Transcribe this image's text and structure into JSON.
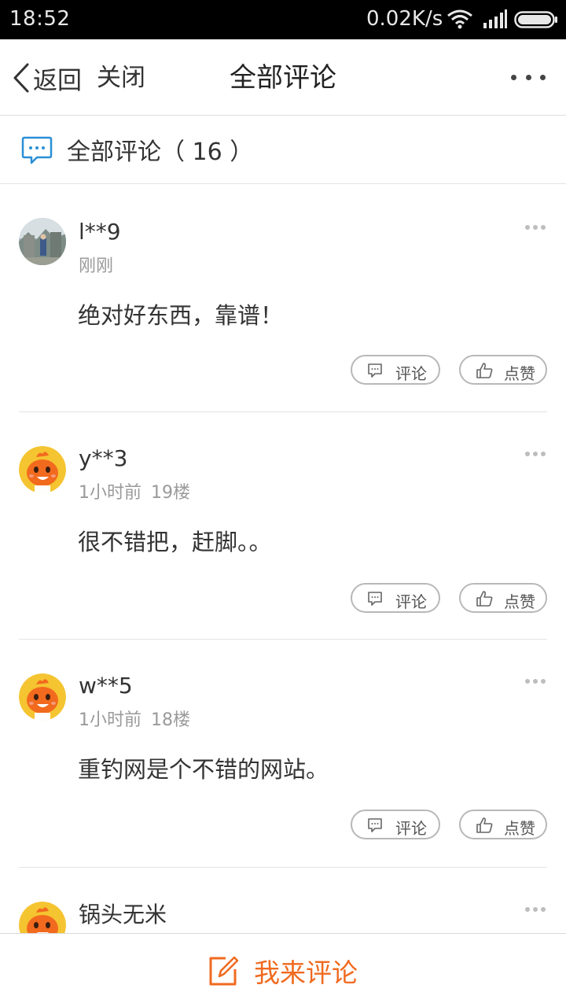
{
  "status_bar": {
    "time": "18:52",
    "net_speed": "0.02K/s",
    "wifi_icon": "wifi-icon",
    "signal_icon": "signal-icon",
    "battery_icon": "battery-icon"
  },
  "nav": {
    "back_label": "返回",
    "close_label": "关闭",
    "title": "全部评论",
    "more_icon": "more-horizontal-icon"
  },
  "section": {
    "title": "全部评论（ 16 ）",
    "icon": "comment-bubble-icon"
  },
  "comments": [
    {
      "user": "l**9",
      "time": "刚刚",
      "floor": "",
      "text": "绝对好东西，靠谱！",
      "comment_label": "评论",
      "like_label": "点赞",
      "avatar": "photo-avatar"
    },
    {
      "user": "y**3",
      "time": "1小时前",
      "floor": "19楼",
      "text": "很不错把，赶脚。。",
      "comment_label": "评论",
      "like_label": "点赞",
      "avatar": "cartoon-avatar"
    },
    {
      "user": "w**5",
      "time": "1小时前",
      "floor": "18楼",
      "text": "重钓网是个不错的网站。",
      "comment_label": "评论",
      "like_label": "点赞",
      "avatar": "cartoon-avatar"
    },
    {
      "user": "锅头无米",
      "time": "",
      "floor": "",
      "text": "",
      "comment_label": "",
      "like_label": "",
      "avatar": "cartoon-avatar"
    }
  ],
  "bottom": {
    "write_label": "我来评论",
    "write_icon": "edit-icon"
  },
  "colors": {
    "accent": "#f06a1f",
    "icon_blue": "#2b8fd6",
    "status_bar": "#000000"
  }
}
